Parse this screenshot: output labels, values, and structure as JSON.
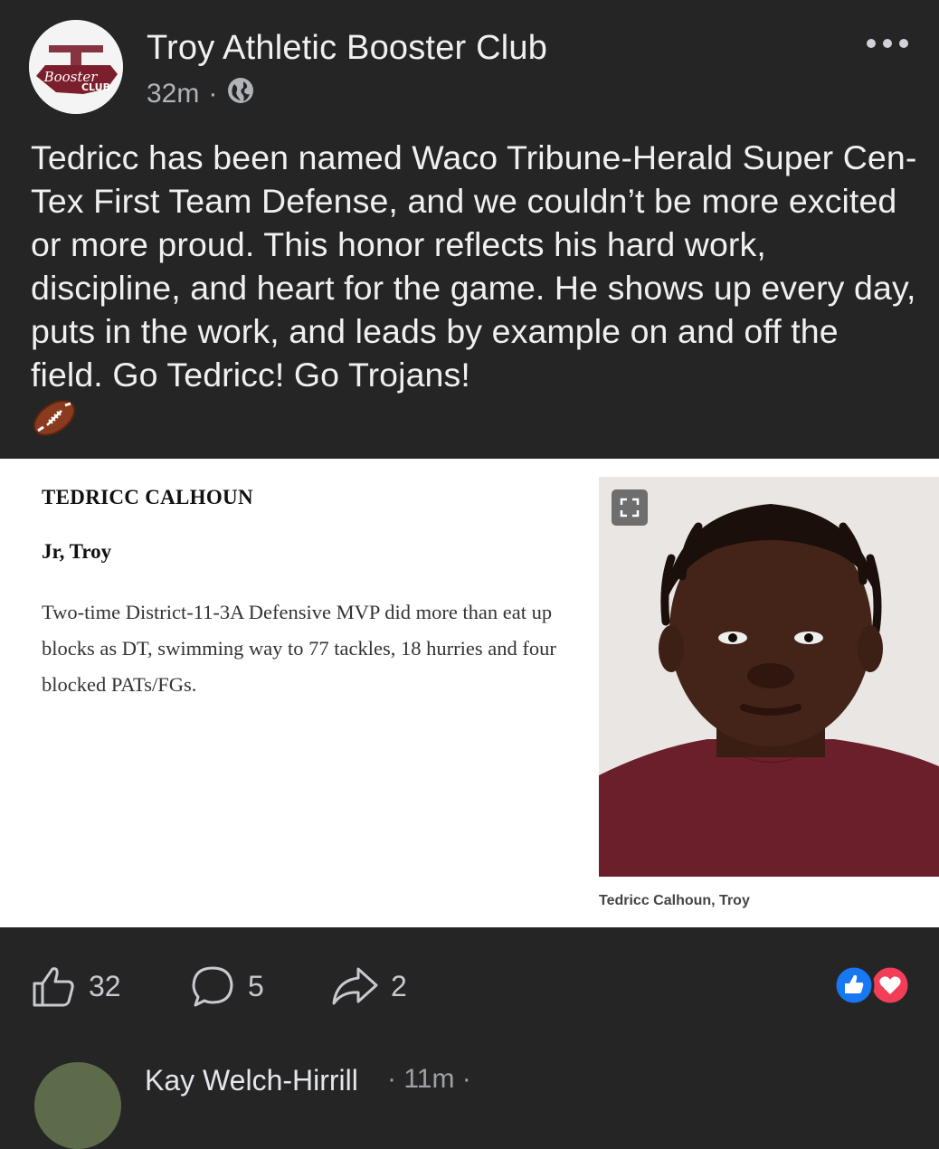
{
  "post": {
    "page_name": "Troy Athletic Booster Club",
    "time": "32m",
    "separator": "·",
    "privacy_icon": "globe-icon",
    "more_icon": "more-horizontal-icon",
    "logo": {
      "text_line1": "Booster",
      "text_line2": "CLUB"
    },
    "text": "Tedricc has been named Waco Tribune-Herald Super Cen-Tex First Team Defense, and we couldn’t be more excited or more proud. This honor reflects his hard work, discipline, and heart for the game. He shows up every day, puts in the work, and leads by example on and off the field. Go Tedricc! Go Trojans!",
    "emoji": "football-emoji"
  },
  "card": {
    "name": "TEDRICC CALHOUN",
    "subtitle": "Jr, Troy",
    "description": "Two-time District-11-3A Defensive MVP did more than eat up blocks as DT, swimming way to 77 tackles, 18 hurries and four blocked PATs/FGs.",
    "photo_caption": "Tedricc Calhoun, Troy",
    "expand_icon": "expand-icon"
  },
  "actions": {
    "like_count": "32",
    "comment_count": "5",
    "share_count": "2",
    "reaction_icons": [
      "like-reaction-icon",
      "love-reaction-icon"
    ]
  },
  "comment": {
    "author": "Kay Welch-Hirrill",
    "time": "· 11m ·"
  },
  "colors": {
    "background": "#252526",
    "card_bg": "#ffffff",
    "like_blue": "#1877f2",
    "love_red": "#f33e58",
    "maroon": "#7a1f2b"
  }
}
